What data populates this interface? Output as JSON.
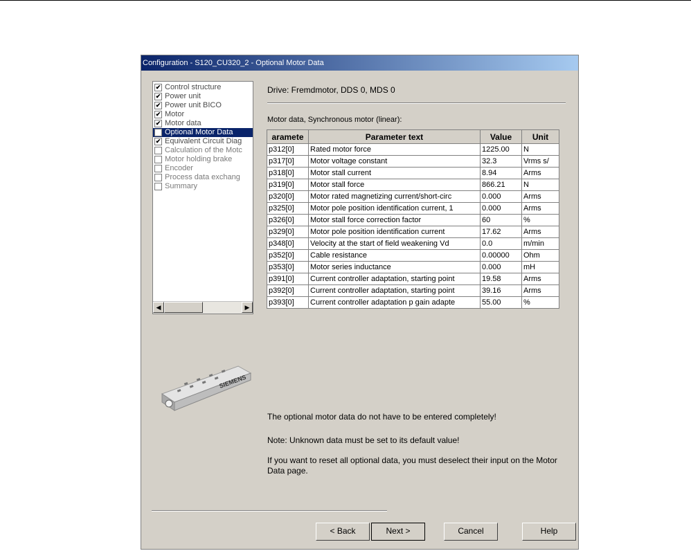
{
  "window": {
    "title": "Configuration - S120_CU320_2 - Optional Motor Data"
  },
  "nav": {
    "items": [
      {
        "label": "Control structure",
        "checked": true,
        "selected": false
      },
      {
        "label": "Power unit",
        "checked": true,
        "selected": false
      },
      {
        "label": "Power unit BICO",
        "checked": true,
        "selected": false
      },
      {
        "label": "Motor",
        "checked": true,
        "selected": false
      },
      {
        "label": "Motor data",
        "checked": true,
        "selected": false
      },
      {
        "label": "Optional Motor Data",
        "checked": false,
        "selected": true
      },
      {
        "label": "Equivalent Circuit Diag",
        "checked": true,
        "selected": false
      },
      {
        "label": "Calculation of the Motc",
        "checked": false,
        "selected": false
      },
      {
        "label": "Motor holding brake",
        "checked": false,
        "selected": false
      },
      {
        "label": "Encoder",
        "checked": false,
        "selected": false
      },
      {
        "label": "Process data exchang",
        "checked": false,
        "selected": false
      },
      {
        "label": "Summary",
        "checked": false,
        "selected": false
      }
    ]
  },
  "drive": {
    "text": "Drive: Fremdmotor, DDS 0, MDS 0"
  },
  "section": {
    "label": "Motor data, Synchronous motor (linear):"
  },
  "table": {
    "headers": [
      "aramete",
      "Parameter text",
      "Value",
      "Unit"
    ],
    "rows": [
      [
        "p312[0]",
        "Rated motor force",
        "1225.00",
        "N"
      ],
      [
        "p317[0]",
        "Motor voltage constant",
        "32.3",
        "Vrms s/"
      ],
      [
        "p318[0]",
        "Motor stall current",
        "8.94",
        "Arms"
      ],
      [
        "p319[0]",
        "Motor stall force",
        "866.21",
        "N"
      ],
      [
        "p320[0]",
        "Motor rated magnetizing current/short-circ",
        "0.000",
        "Arms"
      ],
      [
        "p325[0]",
        "Motor pole position identification current, 1",
        "0.000",
        "Arms"
      ],
      [
        "p326[0]",
        "Motor stall force correction factor",
        "60",
        "%"
      ],
      [
        "p329[0]",
        "Motor pole position identification current",
        "17.62",
        "Arms"
      ],
      [
        "p348[0]",
        "Velocity at the start of field weakening Vd",
        "0.0",
        "m/min"
      ],
      [
        "p352[0]",
        "Cable resistance",
        "0.00000",
        "Ohm"
      ],
      [
        "p353[0]",
        "Motor series inductance",
        "0.000",
        "mH"
      ],
      [
        "p391[0]",
        "Current controller adaptation, starting point",
        "19.58",
        "Arms"
      ],
      [
        "p392[0]",
        "Current controller adaptation, starting point",
        "39.16",
        "Arms"
      ],
      [
        "p393[0]",
        "Current controller adaptation p gain adapte",
        "55.00",
        "%"
      ]
    ]
  },
  "motor_image": {
    "brand": "SIEMENS"
  },
  "notes": {
    "line1": "The optional motor data do not have to be entered completely!",
    "line2": "Note: Unknown data must be set to its default value!",
    "line3": "If you want to reset all optional data, you must deselect their input on the Motor Data page."
  },
  "buttons": {
    "back": "< Back",
    "next": "Next >",
    "cancel": "Cancel",
    "help": "Help"
  },
  "scrollbar": {
    "left_arrow": "◀",
    "right_arrow": "▶"
  },
  "checkmark": "✔",
  "colors": {
    "titlebar_start": "#0a246a",
    "titlebar_end": "#a6caf0",
    "selection": "#0a246a",
    "dialog_bg": "#d4d0c8"
  }
}
